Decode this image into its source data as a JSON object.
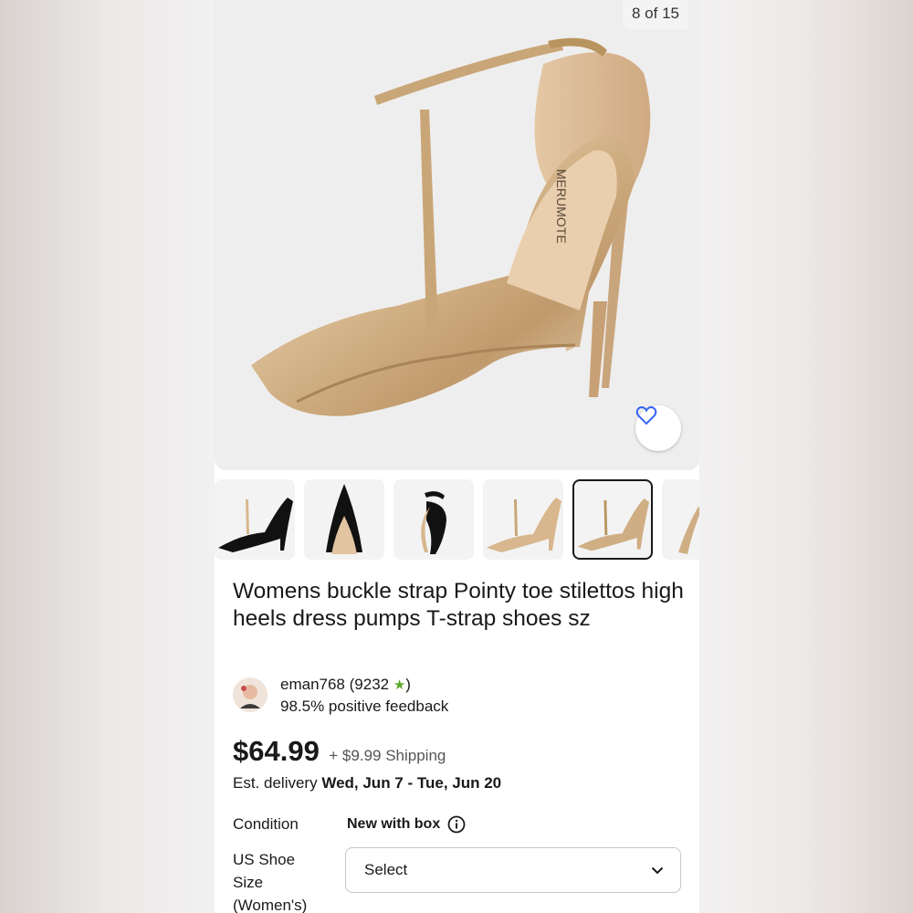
{
  "gallery": {
    "counter": "8 of 15",
    "brand_imprint": "MERUMOTE",
    "thumbnail_count": 6,
    "selected_thumbnail": 5
  },
  "listing": {
    "title": "Womens buckle strap Pointy toe stilettos high heels dress pumps T-strap shoes sz"
  },
  "seller": {
    "name": "eman768",
    "score": "(9232",
    "star": "★",
    "score_close": ")",
    "feedback": "98.5% positive feedback"
  },
  "pricing": {
    "price": "$64.99",
    "shipping": "+ $9.99 Shipping"
  },
  "delivery": {
    "label": "Est. delivery",
    "dates": "Wed, Jun 7 - Tue, Jun 20"
  },
  "condition": {
    "label": "Condition",
    "value": "New with box"
  },
  "size": {
    "label": "US Shoe Size (Women's)",
    "select_value": "Select"
  },
  "colors": {
    "text": "#191919",
    "star": "#5ba829",
    "favorite": "#3665f3",
    "gold": "#d8b78e"
  },
  "icons": [
    "heart-icon",
    "info-icon",
    "chevron-down-icon"
  ]
}
